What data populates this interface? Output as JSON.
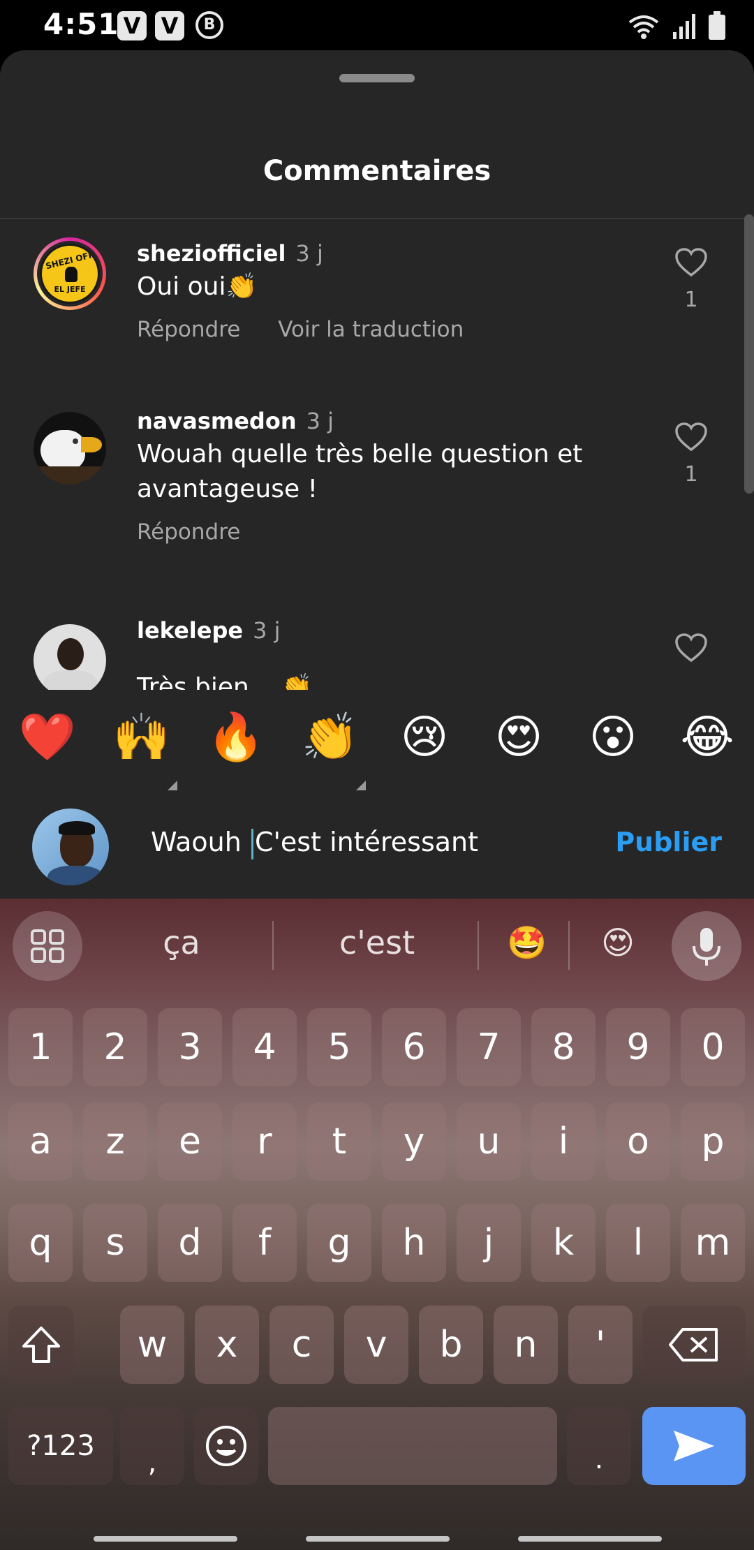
{
  "status_bar": {
    "time": "4:51",
    "app_badges": [
      "V",
      "V"
    ],
    "b_badge": "B"
  },
  "sheet": {
    "title": "Commentaires"
  },
  "comments": [
    {
      "username": "sheziofficiel",
      "time": "3 j",
      "text": "Oui oui👏",
      "reply_label": "Répondre",
      "translate_label": "Voir la traduction",
      "likes": "1"
    },
    {
      "username": "navasmedon",
      "time": "3 j",
      "text": "Wouah quelle très belle question et avantageuse !",
      "reply_label": "Répondre",
      "likes": "1"
    },
    {
      "username": "lekelepe",
      "time": "3 j",
      "text": "Très bien ...👏"
    }
  ],
  "avatar_logo_text": [
    "SHEZI OFF",
    "EL JEFE"
  ],
  "emoji_reactions": [
    "❤️",
    "🙌",
    "🔥",
    "👏",
    "😢",
    "😍",
    "😮",
    "😂"
  ],
  "composer": {
    "text_before_caret": "Waouh ",
    "text_after_caret": "C'est intéressant",
    "publish_label": "Publier"
  },
  "keyboard": {
    "suggestions": [
      "ça",
      "c'est",
      "🤩",
      "😍"
    ],
    "row_numbers": [
      "1",
      "2",
      "3",
      "4",
      "5",
      "6",
      "7",
      "8",
      "9",
      "0"
    ],
    "row1": [
      "a",
      "z",
      "e",
      "r",
      "t",
      "y",
      "u",
      "i",
      "o",
      "p"
    ],
    "row2": [
      "q",
      "s",
      "d",
      "f",
      "g",
      "h",
      "j",
      "k",
      "l",
      "m"
    ],
    "row3": [
      "w",
      "x",
      "c",
      "v",
      "b",
      "n",
      "'"
    ],
    "symbols_label": "?123",
    "comma_label": ",",
    "period_label": "."
  }
}
